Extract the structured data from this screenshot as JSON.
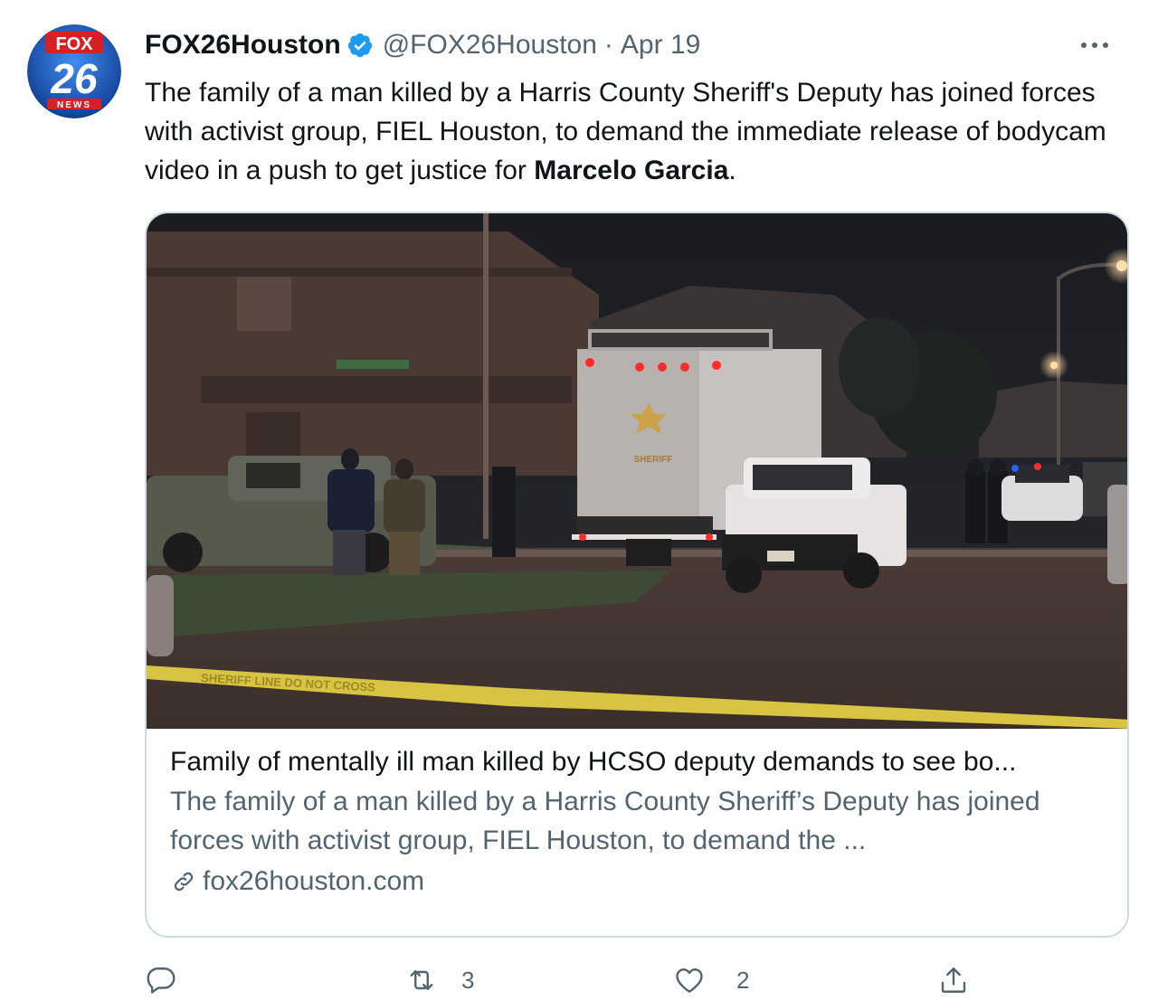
{
  "tweet": {
    "author_name": "FOX26Houston",
    "author_handle": "@FOX26Houston",
    "separator": "·",
    "date": "Apr 19",
    "text_before": "The family of a man killed by a Harris County Sheriff's Deputy has joined forces with activist group, FIEL Houston, to demand the immediate release of bodycam video in a push to get justice for ",
    "text_bold": "Marcelo Garcia",
    "text_after": "."
  },
  "avatar_logo": {
    "top": "FOX",
    "number": "26",
    "bottom": "NEWS"
  },
  "card": {
    "title": "Family of mentally ill man killed by HCSO deputy demands to see bo...",
    "description": "The family of a man killed by a Harris County Sheriff’s Deputy has joined forces with activist group, FIEL Houston, to demand the ...",
    "domain": "fox26houston.com",
    "image_signs": {
      "truck_label": "SHERIFF",
      "tape_text": "SHERIFF LINE DO NOT CROSS"
    }
  },
  "actions": {
    "reply_count": "",
    "retweet_count": "3",
    "like_count": "2"
  },
  "icons": [
    "verified-badge-icon",
    "more-icon",
    "link-icon",
    "reply-icon",
    "retweet-icon",
    "like-icon",
    "share-icon"
  ],
  "colors": {
    "verified": "#1d9bf0",
    "secondary_text": "#536471",
    "border": "#cfd9de",
    "fox_red": "#d71f26",
    "fox_blue": "#1650a8"
  }
}
